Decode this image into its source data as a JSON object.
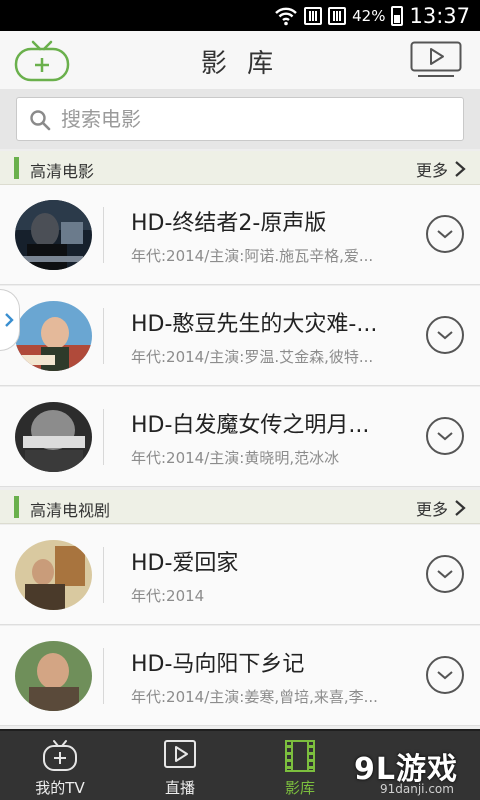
{
  "status_bar": {
    "battery": "42%",
    "time": "13:37"
  },
  "header": {
    "title": "影 库"
  },
  "search": {
    "placeholder": "搜索电影"
  },
  "sections": [
    {
      "title": "高清电影",
      "more": "更多",
      "items": [
        {
          "title": "HD-终结者2-原声版",
          "subtitle": "年代:2014/主演:阿诺.施瓦辛格,爱..."
        },
        {
          "title": "HD-憨豆先生的大灾难-...",
          "subtitle": "年代:2014/主演:罗温.艾金森,彼特..."
        },
        {
          "title": "HD-白发魔女传之明月...",
          "subtitle": "年代:2014/主演:黄晓明,范冰冰"
        }
      ]
    },
    {
      "title": "高清电视剧",
      "more": "更多",
      "items": [
        {
          "title": "HD-爱回家",
          "subtitle": "年代:2014"
        },
        {
          "title": "HD-马向阳下乡记",
          "subtitle": "年代:2014/主演:姜寒,曾培,来喜,李..."
        }
      ]
    }
  ],
  "bottom_nav": [
    {
      "label": "我的TV",
      "icon": "tv-add-icon"
    },
    {
      "label": "直播",
      "icon": "play-icon"
    },
    {
      "label": "影库",
      "icon": "film-icon",
      "active": true
    }
  ],
  "brand": {
    "logo_text": "9L游戏",
    "url": "91danji.com"
  },
  "colors": {
    "accent": "#6ab04c",
    "nav_background": "#333333",
    "active_nav": "#7cbf3e"
  }
}
